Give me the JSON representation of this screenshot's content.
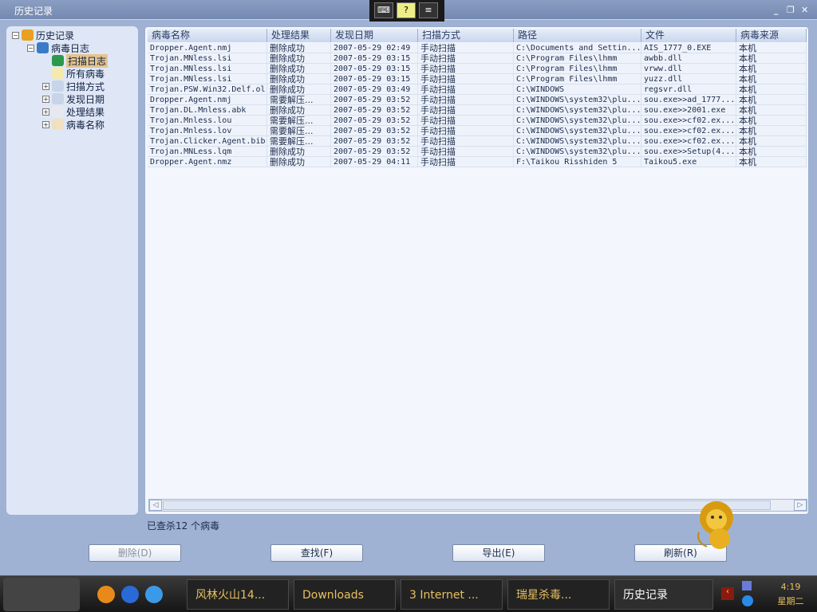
{
  "window": {
    "title": "历史记录"
  },
  "tree": [
    {
      "label": "历史记录",
      "icon": "books-icon",
      "level": 0,
      "expander": "−"
    },
    {
      "label": "病毒日志",
      "icon": "log-book-icon",
      "level": 1,
      "expander": "−"
    },
    {
      "label": "扫描日志",
      "icon": "scan-log-icon",
      "level": 2,
      "expander": "",
      "selected": true
    },
    {
      "label": "所有病毒",
      "icon": "virus-file-icon",
      "level": 2,
      "expander": ""
    },
    {
      "label": "扫描方式",
      "icon": "search-doc-icon",
      "level": 2,
      "expander": "+"
    },
    {
      "label": "发现日期",
      "icon": "clock-doc-icon",
      "level": 2,
      "expander": "+"
    },
    {
      "label": "处理结果",
      "icon": "result-doc-icon",
      "level": 2,
      "expander": "+"
    },
    {
      "label": "病毒名称",
      "icon": "bug-doc-icon",
      "level": 2,
      "expander": "+"
    }
  ],
  "table": {
    "columns": [
      "病毒名称",
      "处理结果",
      "发现日期",
      "扫描方式",
      "路径",
      "文件",
      "病毒来源"
    ],
    "rows": [
      [
        "Dropper.Agent.nmj",
        "删除成功",
        "2007-05-29 02:49",
        "手动扫描",
        "C:\\Documents and Settin...",
        "AIS_1777_0.EXE",
        "本机"
      ],
      [
        "Trojan.MNless.lsi",
        "删除成功",
        "2007-05-29 03:15",
        "手动扫描",
        "C:\\Program Files\\lhmm",
        "awbb.dll",
        "本机"
      ],
      [
        "Trojan.MNless.lsi",
        "删除成功",
        "2007-05-29 03:15",
        "手动扫描",
        "C:\\Program Files\\lhmm",
        "vrww.dll",
        "本机"
      ],
      [
        "Trojan.MNless.lsi",
        "删除成功",
        "2007-05-29 03:15",
        "手动扫描",
        "C:\\Program Files\\lhmm",
        "yuzz.dll",
        "本机"
      ],
      [
        "Trojan.PSW.Win32.Delf.ol",
        "删除成功",
        "2007-05-29 03:49",
        "手动扫描",
        "C:\\WINDOWS",
        "regsvr.dll",
        "本机"
      ],
      [
        "Dropper.Agent.nmj",
        "需要解压...",
        "2007-05-29 03:52",
        "手动扫描",
        "C:\\WINDOWS\\system32\\plu...",
        "sou.exe>>ad_1777...",
        "本机"
      ],
      [
        "Trojan.DL.Mnless.abk",
        "删除成功",
        "2007-05-29 03:52",
        "手动扫描",
        "C:\\WINDOWS\\system32\\plu...",
        "sou.exe>>2001.exe",
        "本机"
      ],
      [
        "Trojan.Mnless.lou",
        "需要解压...",
        "2007-05-29 03:52",
        "手动扫描",
        "C:\\WINDOWS\\system32\\plu...",
        "sou.exe>>cf02.ex...",
        "本机"
      ],
      [
        "Trojan.Mnless.lov",
        "需要解压...",
        "2007-05-29 03:52",
        "手动扫描",
        "C:\\WINDOWS\\system32\\plu...",
        "sou.exe>>cf02.ex...",
        "本机"
      ],
      [
        "Trojan.Clicker.Agent.bib",
        "需要解压...",
        "2007-05-29 03:52",
        "手动扫描",
        "C:\\WINDOWS\\system32\\plu...",
        "sou.exe>>cf02.ex...",
        "本机"
      ],
      [
        "Trojan.MNLess.lqm",
        "删除成功",
        "2007-05-29 03:52",
        "手动扫描",
        "C:\\WINDOWS\\system32\\plu...",
        "sou.exe>>Setup(4...",
        "本机"
      ],
      [
        "Dropper.Agent.nmz",
        "删除成功",
        "2007-05-29 04:11",
        "手动扫描",
        "F:\\Taikou Risshiden 5",
        "Taikou5.exe",
        "本机"
      ]
    ]
  },
  "status": "已查杀12 个病毒",
  "buttons": {
    "delete": "删除(D)",
    "find": "查找(F)",
    "export": "导出(E)",
    "refresh": "刷新(R)"
  },
  "taskbar": {
    "tasks": [
      "风林火山14...",
      "Downloads",
      "3 Internet ...",
      "瑞星杀毒...",
      "历史记录"
    ],
    "time": "4:19",
    "day": "星期二"
  }
}
